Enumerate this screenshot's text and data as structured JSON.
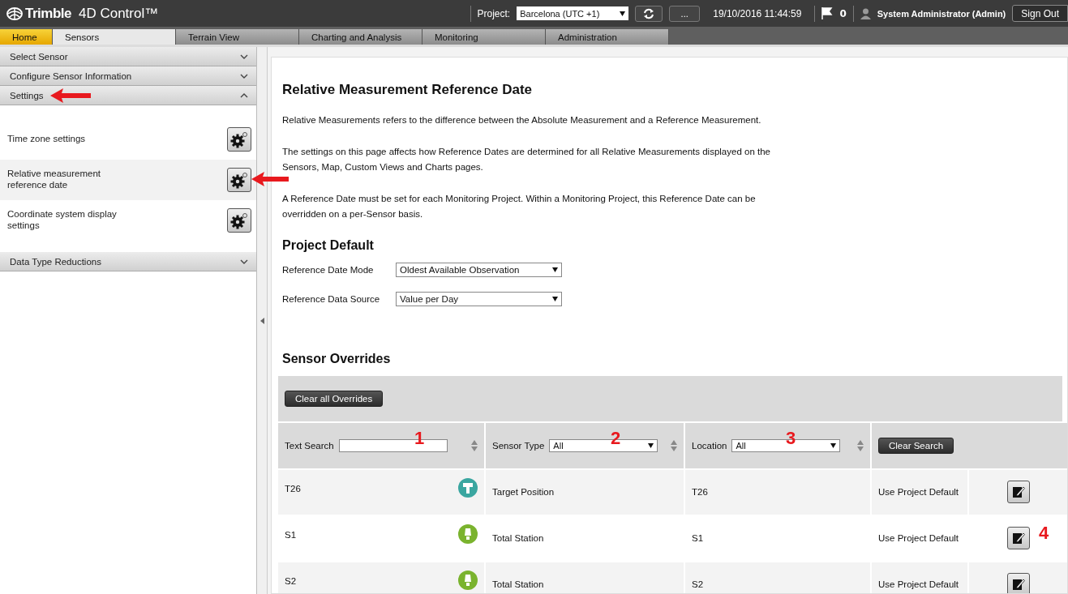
{
  "header": {
    "brand": "Trimble",
    "product": "4D Control™",
    "project_label": "Project:",
    "project": "Barcelona (UTC +1)",
    "more_button": "...",
    "datetime": "19/10/2016 11:44:59",
    "flag_count": "0",
    "user": "System Administrator (Admin)",
    "sign_out": "Sign Out"
  },
  "tabs": [
    {
      "label": "Home",
      "selected": false,
      "kind": "home"
    },
    {
      "label": "Sensors",
      "selected": true,
      "kind": "tab"
    },
    {
      "label": "Terrain View",
      "selected": false,
      "kind": "tab"
    },
    {
      "label": "Charting and Analysis",
      "selected": false,
      "kind": "tab"
    },
    {
      "label": "Monitoring",
      "selected": false,
      "kind": "tab"
    },
    {
      "label": "Administration",
      "selected": false,
      "kind": "tab"
    }
  ],
  "sidebar": {
    "sections": [
      {
        "label": "Select Sensor",
        "expanded": false,
        "arrow": false
      },
      {
        "label": "Configure Sensor Information",
        "expanded": false,
        "arrow": false
      },
      {
        "label": "Settings",
        "expanded": true,
        "arrow": true,
        "items": [
          {
            "label": "Time zone settings",
            "selected": false,
            "arrow": false
          },
          {
            "label": "Relative measurement reference date",
            "selected": true,
            "arrow": true
          },
          {
            "label": "Coordinate system display settings",
            "selected": false,
            "arrow": false
          }
        ]
      },
      {
        "label": "Data Type Reductions",
        "expanded": false,
        "arrow": false
      }
    ]
  },
  "content": {
    "title": "Relative Measurement Reference Date",
    "paragraphs": [
      "Relative Measurements refers to the difference between the Absolute Measurement and a Reference Measurement.",
      "The settings on this page affects how Reference Dates are determined for all Relative Measurements displayed on the Sensors, Map, Custom Views and Charts pages.",
      "A Reference Date must be set for each Monitoring Project. Within a Monitoring Project, this Reference Date can be overridden on a per-Sensor basis."
    ],
    "project_default": {
      "title": "Project Default",
      "fields": [
        {
          "label": "Reference Date Mode",
          "value": "Oldest Available Observation"
        },
        {
          "label": "Reference Data Source",
          "value": "Value per Day"
        }
      ]
    },
    "overrides": {
      "title": "Sensor Overrides",
      "clear_all": "Clear all Overrides",
      "filters": {
        "text_search": {
          "label": "Text Search",
          "annotation": "1"
        },
        "sensor_type": {
          "label": "Sensor Type",
          "value": "All",
          "annotation": "2"
        },
        "location": {
          "label": "Location",
          "value": "All",
          "annotation": "3"
        },
        "clear_search": "Clear Search"
      },
      "rows": [
        {
          "name": "T26",
          "kind": "target",
          "color": "#3aa6a0",
          "type": "Target Position",
          "location": "T26",
          "setting": "Use Project Default"
        },
        {
          "name": "S1",
          "kind": "station",
          "color": "#7ab32e",
          "type": "Total Station",
          "location": "S1",
          "setting": "Use Project Default",
          "annotation": "4"
        },
        {
          "name": "S2",
          "kind": "station",
          "color": "#7ab32e",
          "type": "Total Station",
          "location": "S2",
          "setting": "Use Project Default"
        }
      ]
    }
  }
}
